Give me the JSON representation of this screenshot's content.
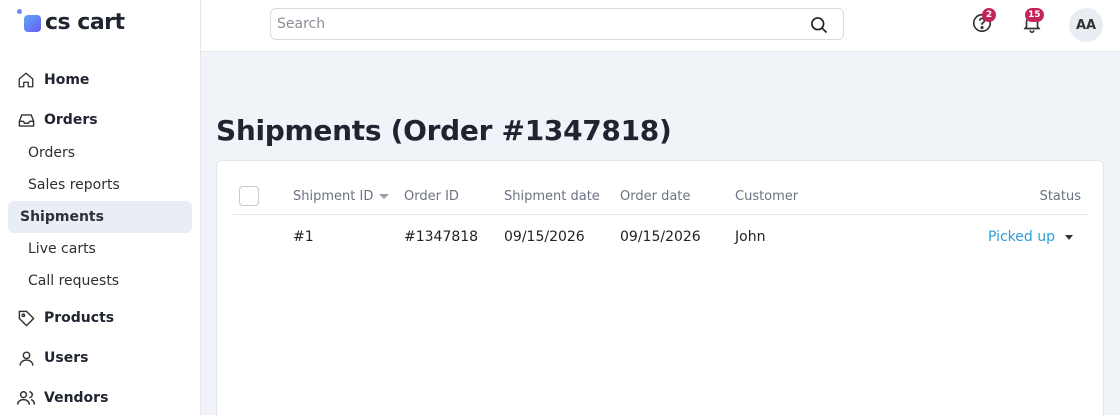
{
  "app": {
    "logo_text": "cs cart"
  },
  "sidebar": {
    "sections": [
      {
        "label": "Home",
        "icon": "home-icon"
      },
      {
        "label": "Orders",
        "icon": "inbox-icon"
      },
      {
        "label": "Products",
        "icon": "tag-icon"
      },
      {
        "label": "Users",
        "icon": "user-icon"
      },
      {
        "label": "Vendors",
        "icon": "users-icon"
      }
    ],
    "orders_sub": [
      {
        "label": "Orders"
      },
      {
        "label": "Sales reports"
      },
      {
        "label": "Shipments",
        "active": true
      },
      {
        "label": "Live carts"
      },
      {
        "label": "Call requests"
      }
    ]
  },
  "header": {
    "search_placeholder": "Search",
    "help_badge": "2",
    "notifications_badge": "15",
    "avatar_initials": "AA"
  },
  "page": {
    "title": "Shipments (Order #1347818)"
  },
  "table": {
    "columns": {
      "shipment_id": "Shipment ID",
      "order_id": "Order ID",
      "shipment_date": "Shipment date",
      "order_date": "Order date",
      "customer": "Customer",
      "status": "Status"
    },
    "rows": [
      {
        "shipment_id": "#1",
        "order_id": "#1347818",
        "shipment_date": "09/15/2026",
        "order_date": "09/15/2026",
        "customer": "John",
        "status": "Picked up"
      }
    ]
  },
  "colors": {
    "accent": "#2d9cd8",
    "badge": "#c4245c",
    "active_bg": "#e9eef6"
  }
}
